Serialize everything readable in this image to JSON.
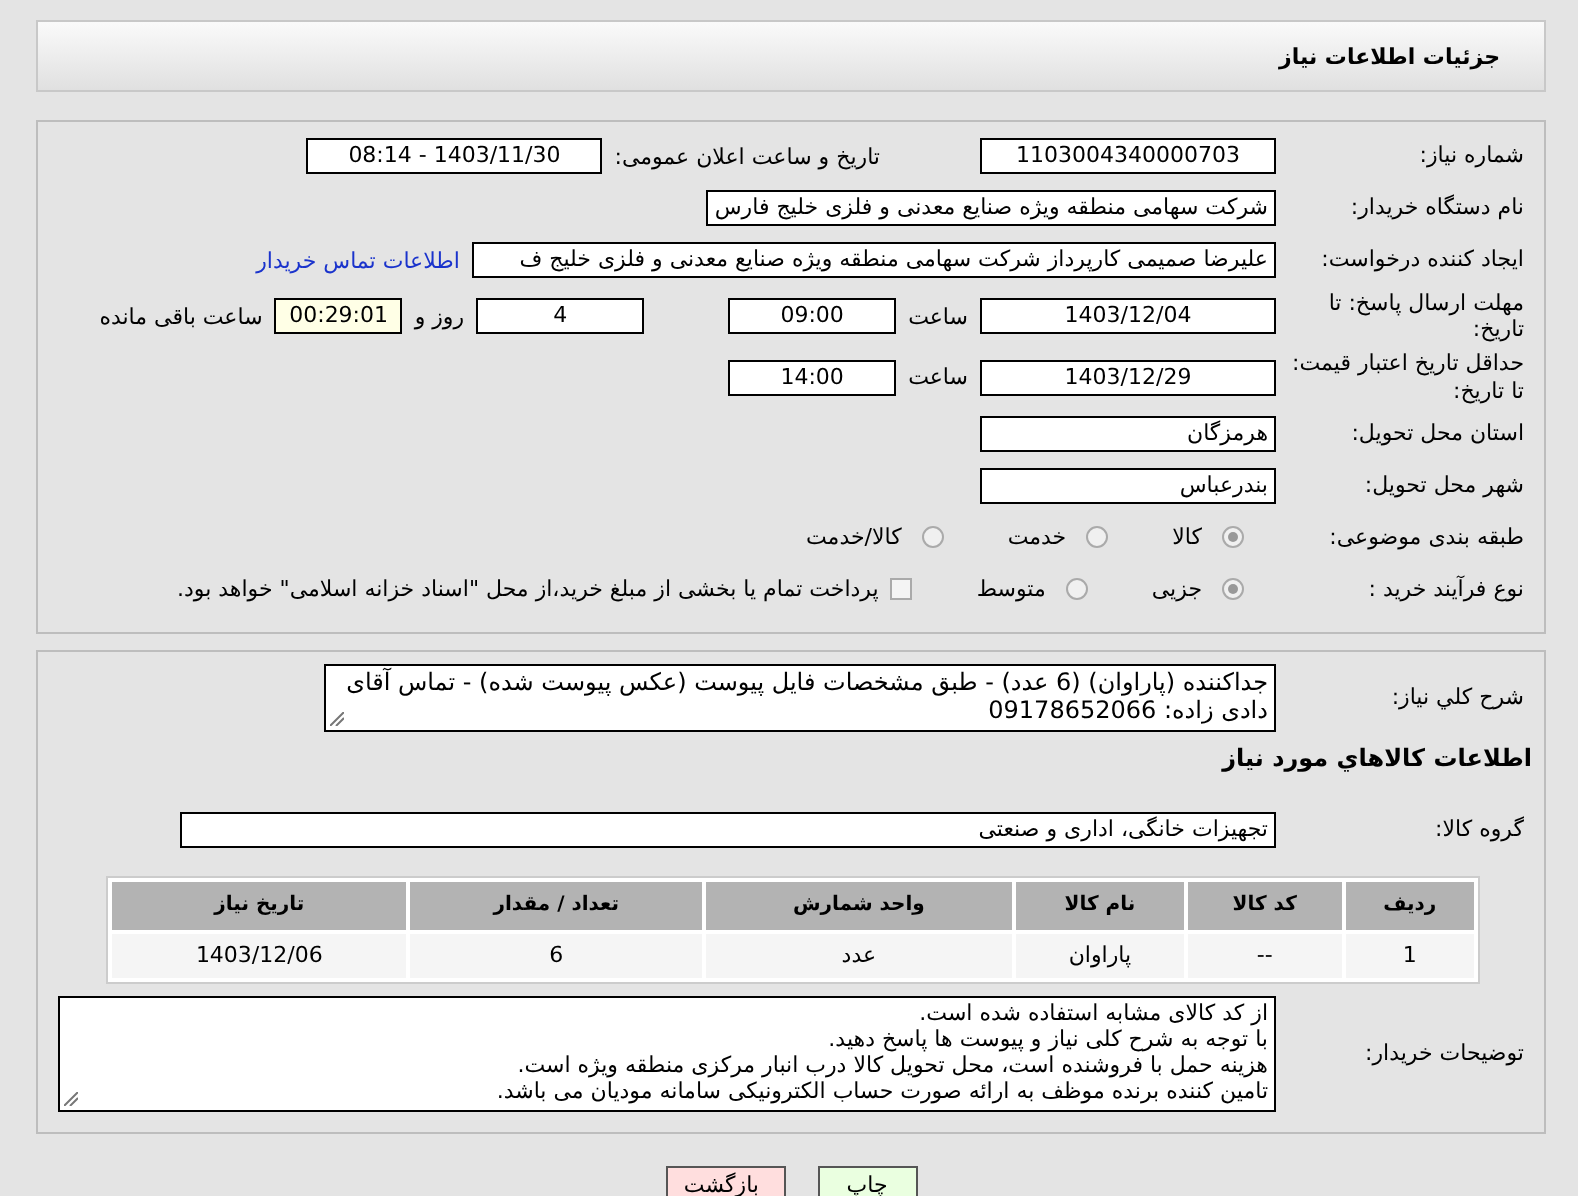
{
  "header": {
    "title": "جزئیات اطلاعات نیاز"
  },
  "need_number": {
    "label": "شماره نیاز:",
    "value": "1103004340000703"
  },
  "announce": {
    "label": "تاریخ و ساعت اعلان عمومی:",
    "value": "1403/11/30 - 08:14"
  },
  "buyer": {
    "label": "نام دستگاه خریدار:",
    "value": "شرکت سهامی منطقه ویژه صنایع معدنی و فلزی خلیج فارس"
  },
  "requester": {
    "label": "ایجاد کننده درخواست:",
    "value": "علیرضا صمیمی کارپرداز شرکت سهامی منطقه ویژه صنایع معدنی و فلزی خلیج ف",
    "link": "اطلاعات تماس خریدار"
  },
  "reply_deadline": {
    "label": "مهلت ارسال پاسخ: تا تاریخ:",
    "date": "1403/12/04",
    "time_label": "ساعت",
    "time": "09:00",
    "days": "4",
    "days_label": "روز و",
    "remaining": "00:29:01",
    "remaining_label": "ساعت باقی مانده"
  },
  "price_validity": {
    "label": "حداقل تاریخ اعتبار قیمت: تا تاریخ:",
    "date": "1403/12/29",
    "time_label": "ساعت",
    "time": "14:00"
  },
  "province": {
    "label": "استان محل تحویل:",
    "value": "هرمزگان"
  },
  "city": {
    "label": "شهر محل تحویل:",
    "value": "بندرعباس"
  },
  "category": {
    "label": "طبقه بندی موضوعی:",
    "options": [
      {
        "label": "کالا",
        "selected": true
      },
      {
        "label": "خدمت",
        "selected": false
      },
      {
        "label": "کالا/خدمت",
        "selected": false
      }
    ]
  },
  "purchase_type": {
    "label": "نوع فرآیند خرید :",
    "options": [
      {
        "label": "جزیی",
        "selected": true
      },
      {
        "label": "متوسط",
        "selected": false
      }
    ],
    "payment": {
      "checked": false,
      "label": "پرداخت تمام یا بخشی از مبلغ خرید،از محل \"اسناد خزانه اسلامی\" خواهد بود."
    }
  },
  "description": {
    "label": "شرح کلي نياز:",
    "value": "جداکننده (پاراوان) (6 عدد) - طبق مشخصات فایل پیوست (عکس پیوست شده) - تماس آقای دادی زاده: 09178652066"
  },
  "goods_heading": "اطلاعات کالاهاي مورد نياز",
  "goods_group": {
    "label": "گروه کالا:",
    "value": "تجهیزات خانگی، اداری و صنعتی"
  },
  "table": {
    "columns": [
      "ردیف",
      "کد کالا",
      "نام کالا",
      "واحد شمارش",
      "تعداد / مقدار",
      "تاریخ نیاز"
    ],
    "rows": [
      [
        "1",
        "--",
        "پاراوان",
        "عدد",
        "6",
        "1403/12/06"
      ]
    ]
  },
  "buyer_notes": {
    "label": "توضیحات خریدار:",
    "lines": [
      "از کد کالای مشابه استفاده شده است.",
      "با توجه به شرح کلی نیاز و پیوست ها پاسخ دهید.",
      "هزینه حمل با فروشنده است، محل تحویل کالا درب انبار مرکزی منطقه ویژه است.",
      "تامین کننده برنده موظف به ارائه صورت حساب الکترونیکی سامانه مودیان می باشد."
    ]
  },
  "buttons": [
    {
      "kind": "print",
      "label": "چاپ"
    },
    {
      "kind": "back",
      "label": "بازگشت"
    }
  ]
}
